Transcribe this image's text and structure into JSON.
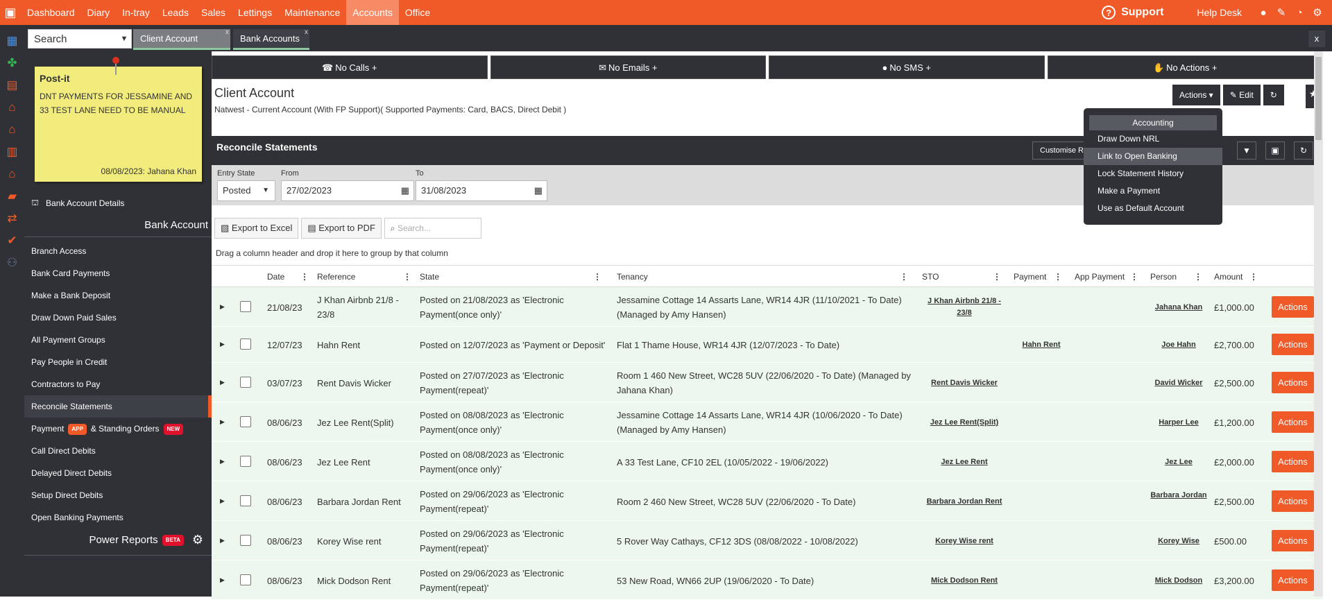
{
  "topnav": {
    "items": [
      "Dashboard",
      "Diary",
      "In-tray",
      "Leads",
      "Sales",
      "Lettings",
      "Maintenance",
      "Accounts",
      "Office"
    ],
    "support": "Support",
    "help_desk": "Help Desk"
  },
  "tabs": {
    "search_placeholder": "Search",
    "items": [
      "Client Account",
      "Bank Accounts"
    ],
    "close": "x",
    "close_all": "x"
  },
  "postit": {
    "title": "Post-it",
    "text": "DNT PAYMENTS FOR JESSAMINE AND 33 TEST LANE NEED TO BE MANUAL",
    "footer": "08/08/2023: Jahana Khan"
  },
  "sidebar": {
    "bank_details": "Bank Account Details",
    "section": "Bank Account",
    "items": [
      "Branch Access",
      "Bank Card Payments",
      "Make a Bank Deposit",
      "Draw Down Paid Sales",
      "All Payment Groups",
      "Pay People in Credit",
      "Contractors to Pay",
      "Reconcile Statements",
      "Call Direct Debits",
      "Delayed Direct Debits",
      "Setup Direct Debits",
      "Open Banking Payments"
    ],
    "payment_prefix": "Payment",
    "payment_badge": "APP",
    "payment_suffix": "& Standing Orders",
    "payment_new": "NEW",
    "power_reports": "Power Reports",
    "power_badge": "BETA"
  },
  "comms": {
    "calls": "No Calls  +",
    "emails": "No Emails  +",
    "sms": "No SMS  +",
    "actions": "No Actions  +"
  },
  "account": {
    "title": "Client Account",
    "subtitle": "Natwest - Current Account (With FP Support)( Supported Payments: Card, BACS, Direct Debit )",
    "actions_btn": "Actions ▾",
    "edit_btn": "Edit"
  },
  "reconcile": {
    "title": "Reconcile Statements",
    "customise": "Customise Rec"
  },
  "filters": {
    "entry_state_label": "Entry State",
    "entry_state": "Posted",
    "from_label": "From",
    "from": "27/02/2023",
    "to_label": "To",
    "to": "31/08/2023"
  },
  "tools": {
    "excel": "Export to Excel",
    "pdf": "Export to PDF",
    "search_placeholder": "Search..."
  },
  "drag_hint": "Drag a column header and drop it here to group by that column",
  "columns": [
    "Date",
    "Reference",
    "State",
    "Tenancy",
    "STO",
    "Payment",
    "App Payment",
    "Person",
    "Amount"
  ],
  "rows": [
    {
      "date": "21/08/23",
      "ref": "J Khan Airbnb 21/8 - 23/8",
      "state": "Posted on 21/08/2023 as 'Electronic Payment(once only)'",
      "tenancy": "Jessamine Cottage 14 Assarts Lane, WR14 4JR (11/10/2021 - To Date) (Managed by Amy Hansen)",
      "sto": "J Khan Airbnb 21/8 - 23/8",
      "payment": "",
      "person": "Jahana Khan",
      "amount": "£1,000.00",
      "action": "Actions"
    },
    {
      "date": "12/07/23",
      "ref": "Hahn Rent",
      "state": "Posted on 12/07/2023 as 'Payment or Deposit'",
      "tenancy": "Flat 1 Thame House, WR14 4JR (12/07/2023 - To Date)",
      "sto": "",
      "payment": "Hahn Rent",
      "person": "Joe Hahn",
      "amount": "£2,700.00",
      "action": "Actions"
    },
    {
      "date": "03/07/23",
      "ref": "Rent Davis Wicker",
      "state": "Posted on 27/07/2023 as 'Electronic Payment(repeat)'",
      "tenancy": "Room 1 460 New Street, WC28 5UV (22/06/2020 - To Date) (Managed by Jahana Khan)",
      "sto": "Rent Davis Wicker",
      "payment": "",
      "person": "David Wicker",
      "amount": "£2,500.00",
      "action": "Actions"
    },
    {
      "date": "08/06/23",
      "ref": "Jez Lee Rent(Split)",
      "state": "Posted on 08/08/2023 as 'Electronic Payment(once only)'",
      "tenancy": "Jessamine Cottage 14 Assarts Lane, WR14 4JR (10/06/2020 - To Date) (Managed by Amy Hansen)",
      "sto": "Jez Lee Rent(Split)",
      "payment": "",
      "person": "Harper Lee",
      "amount": "£1,200.00",
      "action": "Actions"
    },
    {
      "date": "08/06/23",
      "ref": "Jez Lee Rent",
      "state": "Posted on 08/08/2023 as 'Electronic Payment(once only)'",
      "tenancy": "A 33 Test Lane, CF10 2EL (10/05/2022 - 19/06/2022)",
      "sto": "Jez Lee Rent",
      "payment": "",
      "person": "Jez Lee",
      "amount": "£2,000.00",
      "action": "Actions"
    },
    {
      "date": "08/06/23",
      "ref": "Barbara Jordan Rent",
      "state": "Posted on 29/06/2023 as 'Electronic Payment(repeat)'",
      "tenancy": "Room 2 460 New Street, WC28 5UV (22/06/2020 - To Date)",
      "sto": "Barbara Jordan Rent",
      "payment": "",
      "person": "Barbara Jordan",
      "amount": "£2,500.00",
      "action": "Actions"
    },
    {
      "date": "08/06/23",
      "ref": "Korey Wise rent",
      "state": "Posted on 29/06/2023 as 'Electronic Payment(repeat)'",
      "tenancy": "5 Rover Way Cathays, CF12 3DS (08/08/2022 - 10/08/2022)",
      "sto": "Korey Wise rent",
      "payment": "",
      "person": "Korey Wise",
      "amount": "£500.00",
      "action": "Actions"
    },
    {
      "date": "08/06/23",
      "ref": "Mick Dodson Rent",
      "state": "Posted on 29/06/2023 as 'Electronic Payment(repeat)'",
      "tenancy": "53 New Road, WN66 2UP (19/06/2020 - To Date)",
      "sto": "Mick Dodson Rent",
      "payment": "",
      "person": "Mick Dodson",
      "amount": "£3,200.00",
      "action": "Actions"
    }
  ],
  "dropdown": {
    "header": "Accounting",
    "items": [
      "Draw Down NRL",
      "Link to Open Banking",
      "Lock Statement History",
      "Make a Payment",
      "Use as Default Account"
    ]
  },
  "colors": {
    "brand": "#f05a28",
    "dark": "#2f3136",
    "row_bg": "#eef7ee"
  }
}
